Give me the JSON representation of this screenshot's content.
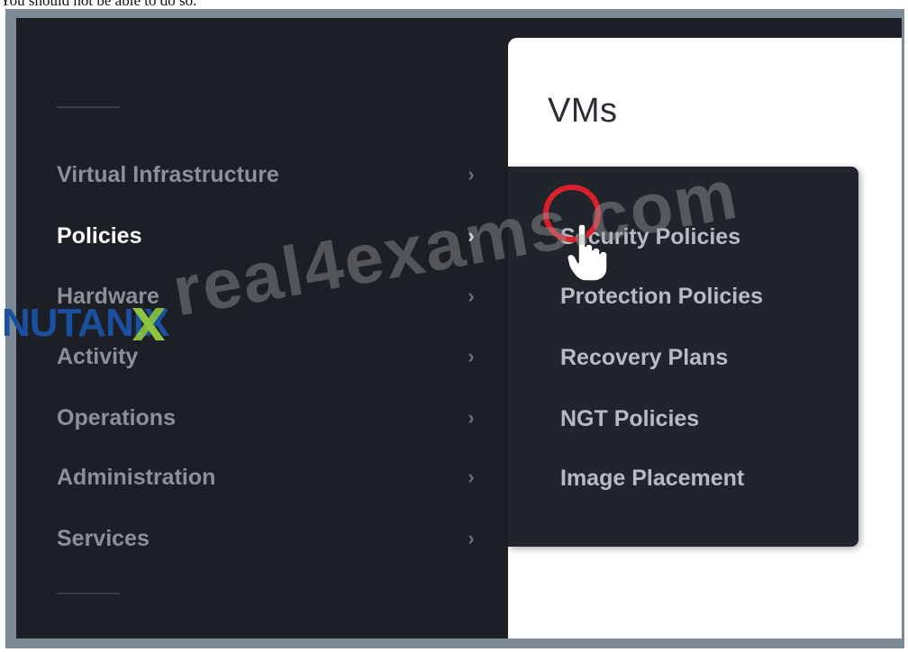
{
  "caption": "You should not be able to do so.",
  "content": {
    "title": "VMs"
  },
  "nav": {
    "items": [
      {
        "label": "Virtual Infrastructure",
        "chevron": "›"
      },
      {
        "label": "Policies",
        "chevron": "›"
      },
      {
        "label": "Hardware",
        "chevron": "›"
      },
      {
        "label": "Activity",
        "chevron": "›"
      },
      {
        "label": "Operations",
        "chevron": "›"
      },
      {
        "label": "Administration",
        "chevron": "›"
      },
      {
        "label": "Services",
        "chevron": "›"
      }
    ],
    "active": "Policies"
  },
  "submenu": {
    "items": [
      {
        "label": "Security Policies"
      },
      {
        "label": "Protection Policies"
      },
      {
        "label": "Recovery Plans"
      },
      {
        "label": "NGT Policies"
      },
      {
        "label": "Image Placement"
      }
    ]
  },
  "overlay": {
    "watermark": "real4exams.com",
    "logo": "NUTANIX"
  },
  "colors": {
    "sidebar_bg": "#1c2026",
    "submenu_bg": "#20252c",
    "marker": "#d9202b",
    "logo_blue": "#1b4fa0",
    "logo_green": "#8cc63f"
  }
}
